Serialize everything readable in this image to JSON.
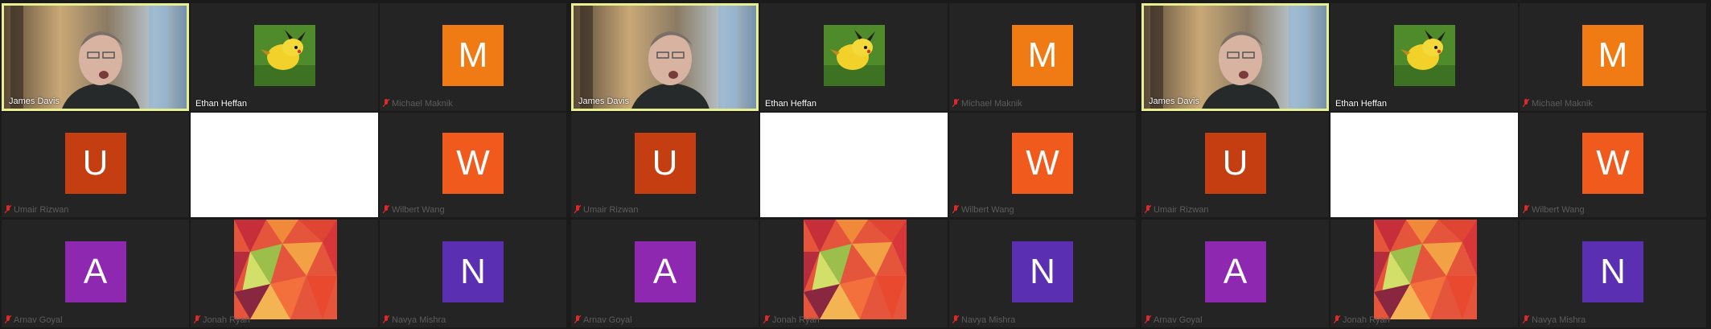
{
  "panels": [
    {
      "host": {
        "name": "James Davis"
      },
      "pikachu": {
        "name": "Ethan Heffan"
      },
      "michael": {
        "name": "Michael Maknik",
        "initial": "M",
        "color": "#f07a13"
      },
      "umair": {
        "name": "Umair Rizwan",
        "initial": "U",
        "color": "#c43e12"
      },
      "wilbert": {
        "name": "Wilbert Wang",
        "initial": "W",
        "color": "#f05a1d"
      },
      "amu": {
        "name": "Arnav Goyal",
        "initial": "A",
        "color": "#8f28b0"
      },
      "jonah": {
        "name": "Jonah Ryan"
      },
      "navya": {
        "name": "Navya Mishra",
        "initial": "N",
        "color": "#5b2fb2"
      }
    },
    {
      "host": {
        "name": "James Davis"
      },
      "pikachu": {
        "name": "Ethan Heffan"
      },
      "michael": {
        "name": "Michael Maknik",
        "initial": "M",
        "color": "#f07a13"
      },
      "umair": {
        "name": "Umair Rizwan",
        "initial": "U",
        "color": "#c43e12"
      },
      "wilbert": {
        "name": "Wilbert Wang",
        "initial": "W",
        "color": "#f05a1d"
      },
      "amu": {
        "name": "Arnav Goyal",
        "initial": "A",
        "color": "#8f28b0"
      },
      "jonah": {
        "name": "Jonah Ryan"
      },
      "navya": {
        "name": "Navya Mishra",
        "initial": "N",
        "color": "#5b2fb2"
      }
    },
    {
      "host": {
        "name": "James Davis"
      },
      "pikachu": {
        "name": "Ethan Heffan"
      },
      "michael": {
        "name": "Michael Maknik",
        "initial": "M",
        "color": "#f07a13"
      },
      "umair": {
        "name": "Umair Rizwan",
        "initial": "U",
        "color": "#c43e12"
      },
      "wilbert": {
        "name": "Wilbert Wang",
        "initial": "W",
        "color": "#f05a1d"
      },
      "amu": {
        "name": "Arnav Goyal",
        "initial": "A",
        "color": "#8f28b0"
      },
      "jonah": {
        "name": "Jonah Ryan"
      },
      "navya": {
        "name": "Navya Mishra",
        "initial": "N",
        "color": "#5b2fb2"
      }
    }
  ],
  "colors": {
    "active_border": "#e7ef92",
    "tile_bg": "#242424"
  }
}
